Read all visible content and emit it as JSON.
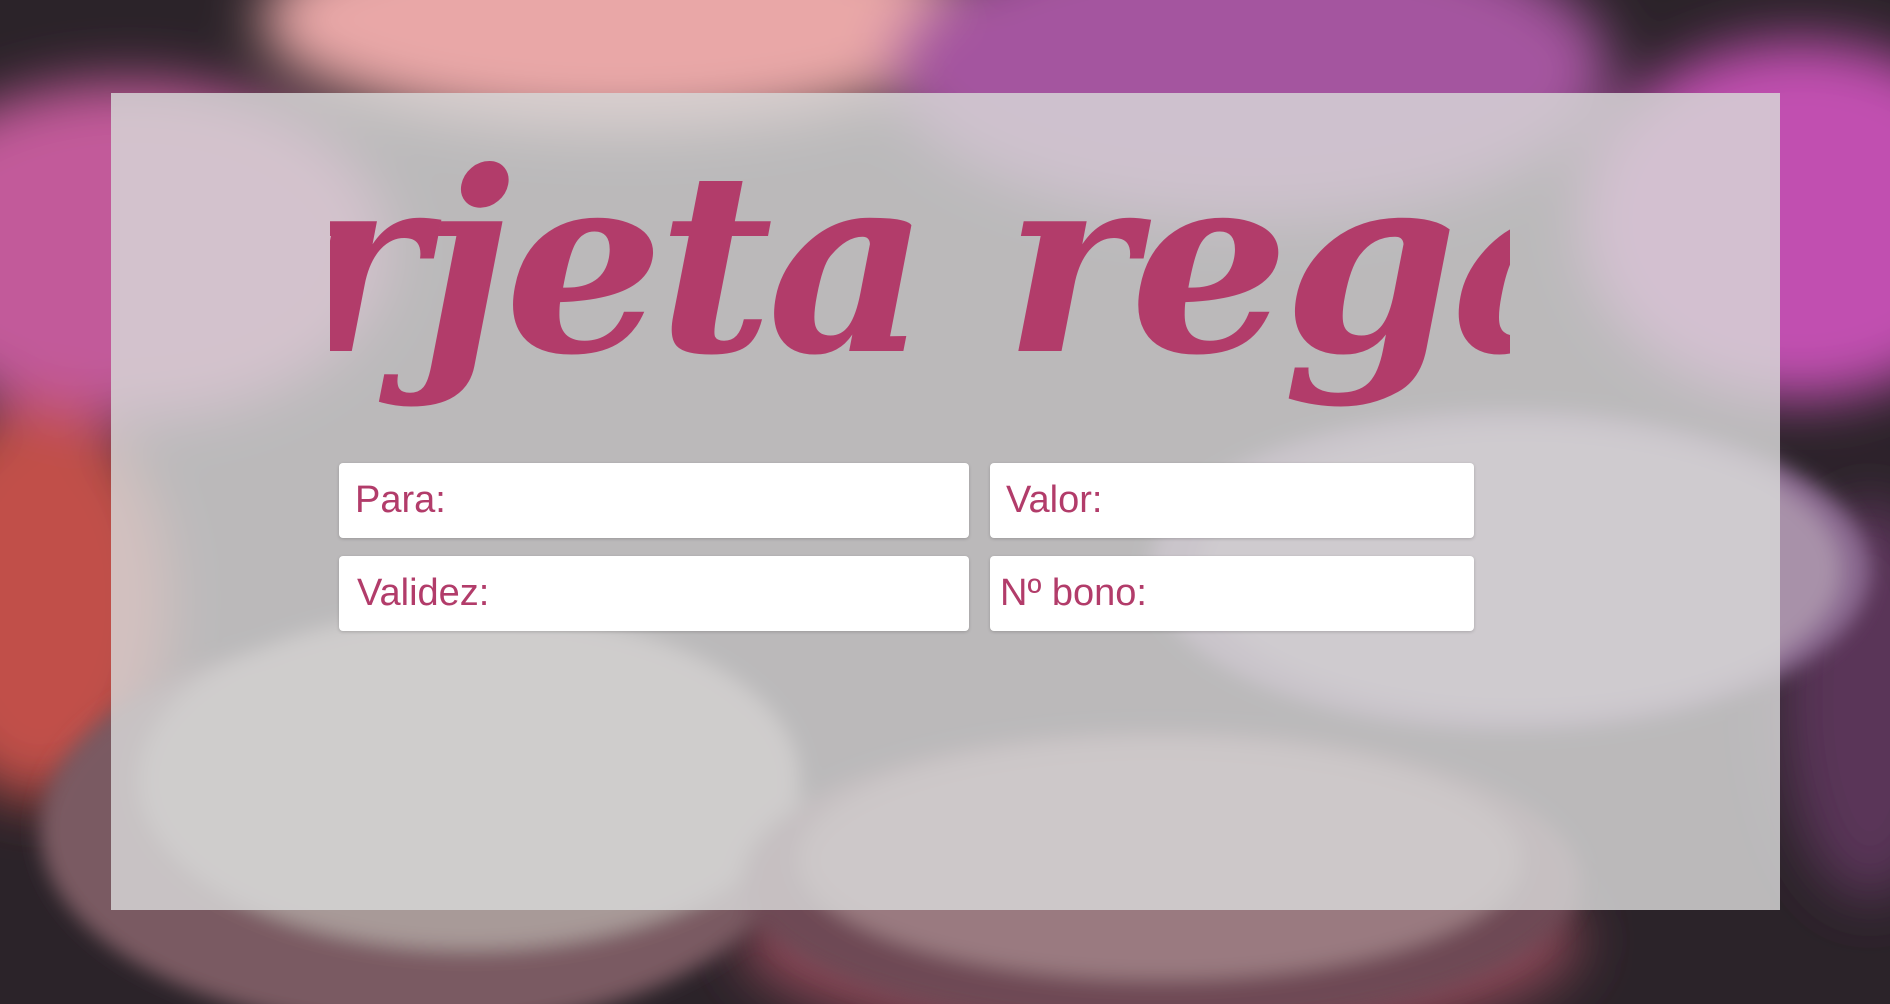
{
  "card": {
    "title": "Tarjeta regalo",
    "fields": {
      "para": "Para:",
      "valor": "Valor:",
      "validez": "Validez:",
      "bono": "Nº bono:"
    }
  },
  "colors": {
    "accent": "#b23c6a",
    "panel": "#d6d6d6",
    "field_bg": "#ffffff"
  }
}
